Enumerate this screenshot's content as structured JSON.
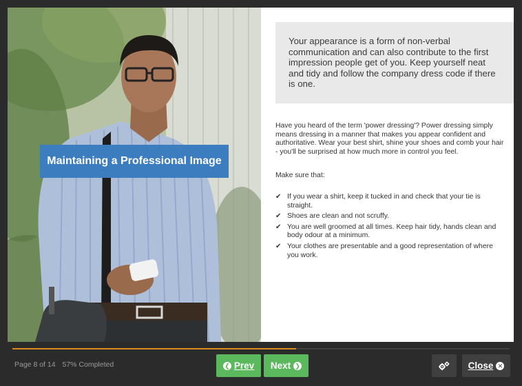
{
  "slide": {
    "title": "Maintaining a Professional Image",
    "callout": "Your appearance is a form of non-verbal communication and can also contribute to the first impression people get of you. Keep yourself neat and tidy and follow the company dress code if there is one.",
    "intro": "Have you heard of the term 'power dressing'? Power dressing simply means dressing in a manner that makes you appear confident and authoritative. Wear your best shirt, shine your shoes and comb your hair - you'll be surprised at how much more in control you feel.",
    "make_sure": "Make sure that:",
    "checklist": [
      "If you wear a shirt, keep it tucked in and check that your tie is straight.",
      "Shoes are clean and not scruffy.",
      "You are well groomed at all times. Keep hair tidy, hands clean and body odour at a minimum.",
      "Your clothes are presentable and a good representation of where you work."
    ],
    "check_icon": "check-icon"
  },
  "footer": {
    "page_label": "Page 8 of 14",
    "progress_label": "57% Completed",
    "progress_fraction": 0.57,
    "prev_label": "Prev",
    "next_label": "Next",
    "close_label": "Close",
    "settings_icon": "gears-icon"
  },
  "colors": {
    "banner": "#3c7dbf",
    "button_green": "#5cb85c",
    "progress": "#e08a1e",
    "footer_bg": "#2b2b2b"
  }
}
